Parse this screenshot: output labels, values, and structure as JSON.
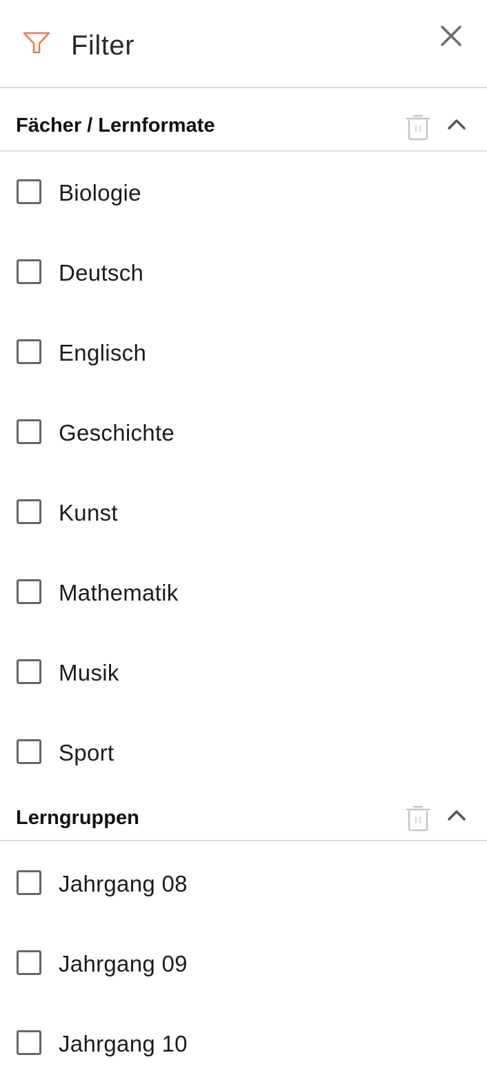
{
  "header": {
    "title": "Filter",
    "accent_color": "#e87a4f"
  },
  "sections": [
    {
      "title": "Fächer / Lernformate",
      "items": [
        "Biologie",
        "Deutsch",
        "Englisch",
        "Geschichte",
        "Kunst",
        "Mathematik",
        "Musik",
        "Sport"
      ]
    },
    {
      "title": "Lerngruppen",
      "items": [
        "Jahrgang 08",
        "Jahrgang 09",
        "Jahrgang 10"
      ]
    }
  ]
}
